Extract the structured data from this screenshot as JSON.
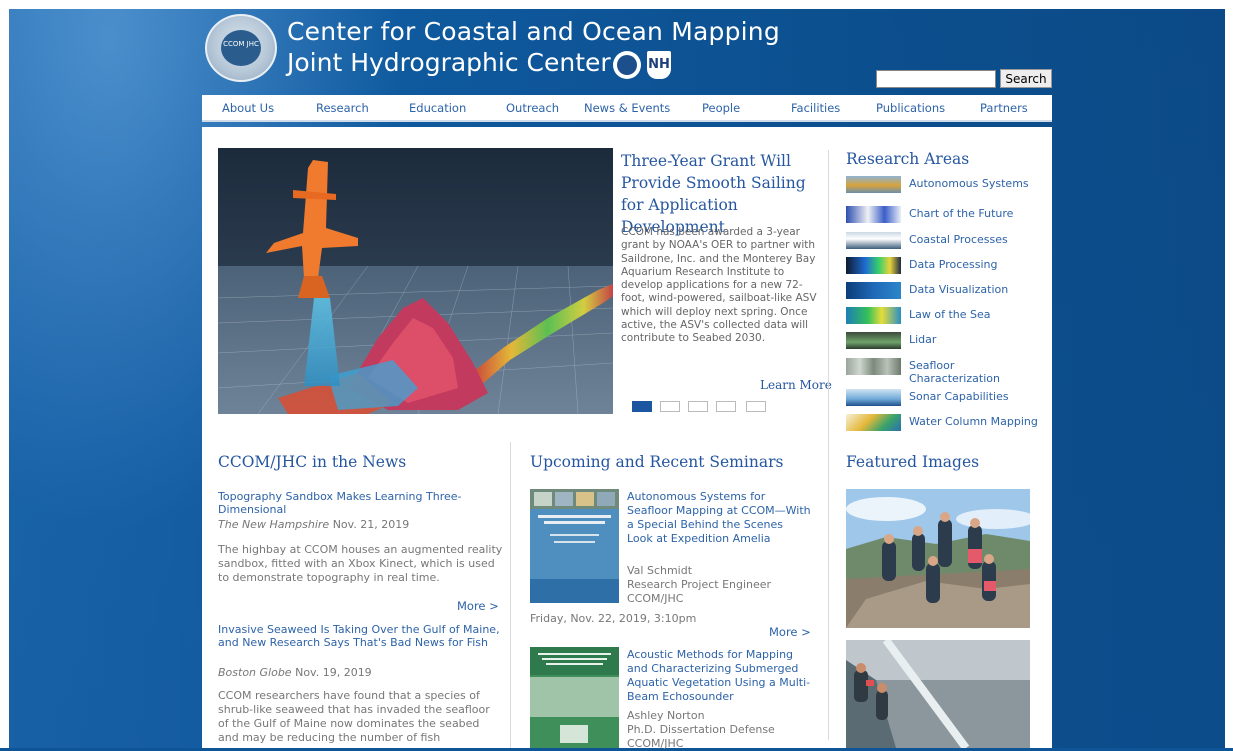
{
  "header": {
    "seal_text": "CCOM JHC",
    "title_line1": "Center for Coastal and Ocean Mapping",
    "title_line2": "Joint Hydrographic Center",
    "unh_logo": "NH"
  },
  "search": {
    "placeholder": "",
    "button_label": "Search"
  },
  "nav": {
    "items": [
      "About Us",
      "Research",
      "Education",
      "Outreach",
      "News & Events",
      "People",
      "Facilities",
      "Publications",
      "Partners"
    ]
  },
  "hero": {
    "title": "Three-Year Grant Will Provide Smooth Sailing for Application Development",
    "body": "CCOM has been awarded a 3-year grant by NOAA's OER to partner with Saildrone, Inc. and the Monterey Bay Aquarium Research Institute to develop applications for a new 72-foot, wind-powered, sailboat-like ASV which will deploy next spring. Once active, the ASV's collected data will contribute to Seabed 2030.",
    "learn_more": "Learn More",
    "slide_count": 5,
    "active_slide": 1
  },
  "research_areas": {
    "title": "Research Areas",
    "items": [
      {
        "label": "Autonomous Systems",
        "icon": "autonomous-systems-thumb"
      },
      {
        "label": "Chart of the Future",
        "icon": "chart-of-future-thumb"
      },
      {
        "label": "Coastal Processes",
        "icon": "coastal-processes-thumb"
      },
      {
        "label": "Data Processing",
        "icon": "data-processing-thumb"
      },
      {
        "label": "Data Visualization",
        "icon": "data-visualization-thumb"
      },
      {
        "label": "Law of the Sea",
        "icon": "law-of-sea-thumb"
      },
      {
        "label": "Lidar",
        "icon": "lidar-thumb"
      },
      {
        "label": "Seafloor Characterization",
        "icon": "seafloor-thumb"
      },
      {
        "label": "Sonar Capabilities",
        "icon": "sonar-thumb"
      },
      {
        "label": "Water Column Mapping",
        "icon": "water-column-thumb"
      }
    ]
  },
  "news": {
    "title": "CCOM/JHC in the News",
    "items": [
      {
        "headline": "Topography Sandbox Makes Learning Three-Dimensional",
        "source": "The New Hampshire",
        "date": "Nov. 21, 2019",
        "body": "The highbay at CCOM houses an augmented reality sandbox, fitted with an Xbox Kinect, which is used to demonstrate topography in real time.",
        "more": "More >"
      },
      {
        "headline": "Invasive Seaweed Is Taking Over the Gulf of Maine, and New Research Says That's Bad News for Fish",
        "source": "Boston Globe",
        "date": "Nov. 19, 2019",
        "body": "CCOM researchers have found that a species of shrub-like seaweed that has invaded the seafloor of the Gulf of Maine now dominates the seabed and may be reducing the number of fish"
      }
    ]
  },
  "seminars": {
    "title": "Upcoming and Recent Seminars",
    "items": [
      {
        "title": "Autonomous Systems for Seafloor Mapping at CCOM—With a Special Behind the Scenes Look at Expedition Amelia",
        "speaker": "Val Schmidt",
        "role": "Research Project Engineer",
        "org": "CCOM/JHC",
        "date": "Friday, Nov. 22, 2019, 3:10pm",
        "more": "More >"
      },
      {
        "title": "Acoustic Methods for Mapping and Characterizing Submerged Aquatic Vegetation Using a Multi-Beam Echosounder",
        "speaker": "Ashley Norton",
        "role": "Ph.D. Dissertation Defense",
        "org": "CCOM/JHC"
      }
    ]
  },
  "featured": {
    "title": "Featured Images"
  },
  "colors": {
    "link": "#2d63a8",
    "heading": "#2556a0",
    "background": "#0d5597",
    "text_muted": "#777777"
  }
}
